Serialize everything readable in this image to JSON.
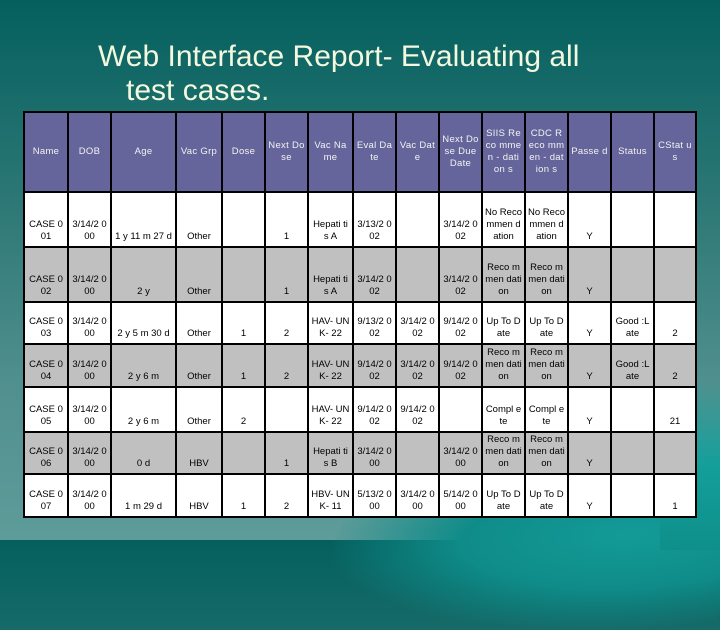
{
  "slide": {
    "title_line1": "Web Interface Report- Evaluating all",
    "title_line2": "test cases."
  },
  "table": {
    "columns": [
      {
        "key": "name",
        "label": "Name"
      },
      {
        "key": "dob",
        "label": "DOB"
      },
      {
        "key": "age",
        "label": "Age"
      },
      {
        "key": "vac_grp",
        "label": "Vac Grp"
      },
      {
        "key": "dose",
        "label": "Dose"
      },
      {
        "key": "next_dose",
        "label": "Next Dose"
      },
      {
        "key": "vac_name",
        "label": "Vac Name"
      },
      {
        "key": "eval_date",
        "label": "Eval Date"
      },
      {
        "key": "vac_date",
        "label": "Vac Date"
      },
      {
        "key": "next_dose_due_date",
        "label": "Next Dose Due Date"
      },
      {
        "key": "siis_recommendations",
        "label": "SIIS Reco mmen - dation s"
      },
      {
        "key": "cdc_recommendations",
        "label": "CDC Reco mmen - dation s"
      },
      {
        "key": "passed",
        "label": "Passe d"
      },
      {
        "key": "status",
        "label": "Status"
      },
      {
        "key": "cstatus",
        "label": "CStat us"
      }
    ],
    "rows": [
      {
        "name": "CASE 001",
        "dob": "3/14/2 000",
        "age": "1 y 11 m 27 d",
        "vac_grp": "Other",
        "dose": "",
        "next_dose": "1",
        "vac_name": "Hepati tis A",
        "eval_date": "3/13/2 002",
        "vac_date": "",
        "next_dose_due_date": "3/14/2 002",
        "siis_recommendations": "No Reco mmen dation",
        "cdc_recommendations": "No Reco mmen dation",
        "passed": "Y",
        "status": "",
        "cstatus": ""
      },
      {
        "name": "CASE 002",
        "dob": "3/14/2 000",
        "age": "2 y",
        "vac_grp": "Other",
        "dose": "",
        "next_dose": "1",
        "vac_name": "Hepati tis A",
        "eval_date": "3/14/2 002",
        "vac_date": "",
        "next_dose_due_date": "3/14/2 002",
        "siis_recommendations": "Reco mmen dation",
        "cdc_recommendations": "Reco mmen dation",
        "passed": "Y",
        "status": "",
        "cstatus": ""
      },
      {
        "name": "CASE 003",
        "dob": "3/14/2 000",
        "age": "2 y 5 m 30 d",
        "vac_grp": "Other",
        "dose": "1",
        "next_dose": "2",
        "vac_name": "HAV- UNK- 22",
        "eval_date": "9/13/2 002",
        "vac_date": "3/14/2 002",
        "next_dose_due_date": "9/14/2 002",
        "siis_recommendations": "Up To Date",
        "cdc_recommendations": "Up To Date",
        "passed": "Y",
        "status": "Good :Late",
        "cstatus": "2"
      },
      {
        "name": "CASE 004",
        "dob": "3/14/2 000",
        "age": "2 y 6 m",
        "vac_grp": "Other",
        "dose": "1",
        "next_dose": "2",
        "vac_name": "HAV- UNK- 22",
        "eval_date": "9/14/2 002",
        "vac_date": "3/14/2 002",
        "next_dose_due_date": "9/14/2 002",
        "siis_recommendations": "Reco mmen dation",
        "cdc_recommendations": "Reco mmen dation",
        "passed": "Y",
        "status": "Good :Late",
        "cstatus": "2"
      },
      {
        "name": "CASE 005",
        "dob": "3/14/2 000",
        "age": "2 y 6 m",
        "vac_grp": "Other",
        "dose": "2",
        "next_dose": "",
        "vac_name": "HAV- UNK- 22",
        "eval_date": "9/14/2 002",
        "vac_date": "9/14/2 002",
        "next_dose_due_date": "",
        "siis_recommendations": "Compl ete",
        "cdc_recommendations": "Compl ete",
        "passed": "Y",
        "status": "",
        "cstatus": "21"
      },
      {
        "name": "CASE 006",
        "dob": "3/14/2 000",
        "age": "0 d",
        "vac_grp": "HBV",
        "dose": "",
        "next_dose": "1",
        "vac_name": "Hepati tis B",
        "eval_date": "3/14/2 000",
        "vac_date": "",
        "next_dose_due_date": "3/14/2 000",
        "siis_recommendations": "Reco mmen dation",
        "cdc_recommendations": "Reco mmen dation",
        "passed": "Y",
        "status": "",
        "cstatus": ""
      },
      {
        "name": "CASE 007",
        "dob": "3/14/2 000",
        "age": "1 m 29 d",
        "vac_grp": "HBV",
        "dose": "1",
        "next_dose": "2",
        "vac_name": "HBV- UNK- 11",
        "eval_date": "5/13/2 000",
        "vac_date": "3/14/2 000",
        "next_dose_due_date": "5/14/2 000",
        "siis_recommendations": "Up To Date",
        "cdc_recommendations": "Up To Date",
        "passed": "Y",
        "status": "",
        "cstatus": "1"
      }
    ]
  }
}
